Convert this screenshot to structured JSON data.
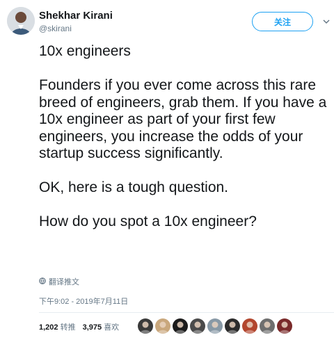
{
  "author": {
    "name": "Shekhar Kirani",
    "handle": "@skirani"
  },
  "actions": {
    "follow_label": "关注"
  },
  "tweet": {
    "paragraphs": [
      "10x engineers",
      "Founders if you ever come across this rare breed of engineers, grab them. If you have a 10x engineer as part of your first few engineers, you increase the odds of your startup success significantly.",
      "OK, here is a tough question.",
      "How do you spot a 10x engineer?"
    ],
    "translate_label": "翻译推文",
    "timestamp": "下午9:02 - 2019年7月11日"
  },
  "stats": {
    "retweets_count": "1,202",
    "retweets_label": "转推",
    "likes_count": "3,975",
    "likes_label": "喜欢"
  },
  "likers": [
    {
      "name": "liker-1",
      "color": "#3a3a3a"
    },
    {
      "name": "liker-2",
      "color": "#c9a77c"
    },
    {
      "name": "liker-3",
      "color": "#1b1b1b"
    },
    {
      "name": "liker-4",
      "color": "#4a4a4a"
    },
    {
      "name": "liker-5",
      "color": "#8899a6"
    },
    {
      "name": "liker-6",
      "color": "#2b2b2b"
    },
    {
      "name": "liker-7",
      "color": "#b2462e"
    },
    {
      "name": "liker-8",
      "color": "#6e6e6e"
    },
    {
      "name": "liker-9",
      "color": "#7a2a2a"
    }
  ],
  "colors": {
    "accent": "#1da1f2",
    "text": "#14171a",
    "muted": "#657786"
  }
}
